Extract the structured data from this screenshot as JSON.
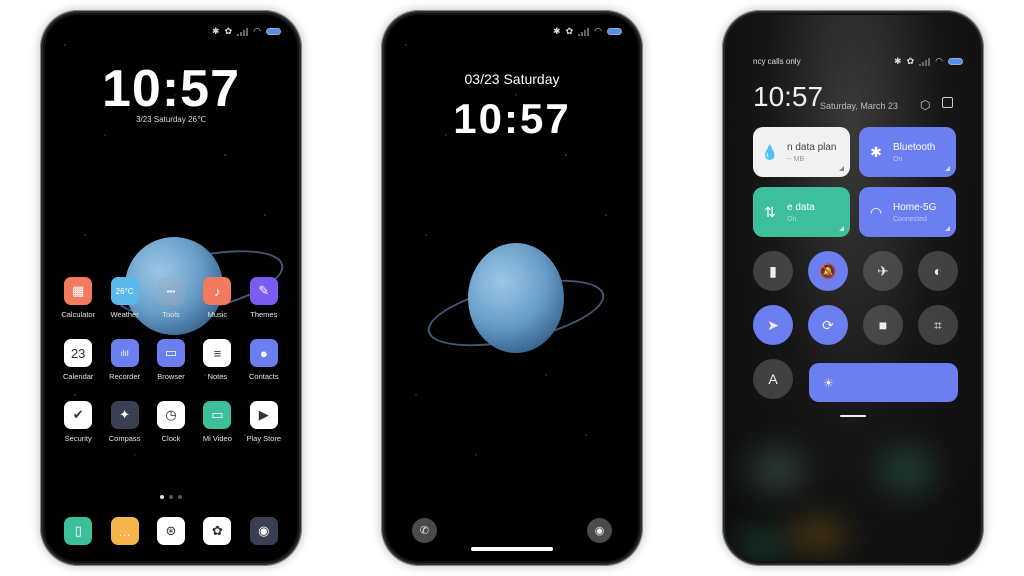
{
  "status_bar": {
    "icons": [
      "bluetooth-icon",
      "dnd-off-icon",
      "signal-icon",
      "wifi-icon",
      "battery-icon"
    ],
    "battery_color": "#4f8ef7"
  },
  "home": {
    "time": "10:57",
    "date_weather": "3/23  Saturday   26℃",
    "apps": [
      {
        "label": "Calculator",
        "icon": "calculator-icon",
        "color": "#f27a5e",
        "glyph": "▦"
      },
      {
        "label": "Weather",
        "icon": "weather-icon",
        "color": "#5ab8ea",
        "glyph": "26°C"
      },
      {
        "label": "Tools",
        "icon": "folder-icon",
        "color": "rgba(160,170,190,0.35)",
        "glyph": "▪▪▪"
      },
      {
        "label": "Music",
        "icon": "music-icon",
        "color": "#f27a5e",
        "glyph": "♪"
      },
      {
        "label": "Themes",
        "icon": "themes-icon",
        "color": "#7b5cf0",
        "glyph": "✎"
      },
      {
        "label": "Calendar",
        "icon": "calendar-icon",
        "color": "#ffffff",
        "glyph": "23"
      },
      {
        "label": "Recorder",
        "icon": "recorder-icon",
        "color": "#6b7ff0",
        "glyph": "ılıl"
      },
      {
        "label": "Browser",
        "icon": "browser-icon",
        "color": "#6b7ff0",
        "glyph": "▭"
      },
      {
        "label": "Notes",
        "icon": "notes-icon",
        "color": "#ffffff",
        "glyph": "≡"
      },
      {
        "label": "Contacts",
        "icon": "contacts-icon",
        "color": "#6b7ff0",
        "glyph": "●"
      },
      {
        "label": "Security",
        "icon": "security-icon",
        "color": "#ffffff",
        "glyph": "✔"
      },
      {
        "label": "Compass",
        "icon": "compass-icon",
        "color": "#3a3f52",
        "glyph": "✦"
      },
      {
        "label": "Clock",
        "icon": "clock-icon",
        "color": "#ffffff",
        "glyph": "◷"
      },
      {
        "label": "Mi Video",
        "icon": "video-icon",
        "color": "#3dbf9c",
        "glyph": "▭"
      },
      {
        "label": "Play Store",
        "icon": "play-store-icon",
        "color": "#ffffff",
        "glyph": "▶"
      }
    ],
    "page_dots": 3,
    "active_page": 0,
    "dock": [
      {
        "name": "phone-app",
        "icon": "phone-app-icon",
        "color": "#3dbf9c",
        "glyph": "▯"
      },
      {
        "name": "messages-app",
        "icon": "messages-icon",
        "color": "#f5b54a",
        "glyph": "…"
      },
      {
        "name": "steering-app",
        "icon": "steering-icon",
        "color": "#ffffff",
        "glyph": "⊛"
      },
      {
        "name": "gallery-app",
        "icon": "gallery-icon",
        "color": "#ffffff",
        "glyph": "✿"
      },
      {
        "name": "camera-app",
        "icon": "camera-icon",
        "color": "#3a3f52",
        "glyph": "◉"
      }
    ]
  },
  "lock": {
    "date": "03/23 Saturday",
    "time": "10:57",
    "phone_glyph": "✆",
    "camera_glyph": "◉"
  },
  "control_center": {
    "carrier": "ncy calls only",
    "time": "10:57",
    "date": "Saturday, March 23",
    "tiles": [
      {
        "name": "data-plan",
        "title": "n data plan",
        "sub": "-- MB",
        "glyph": "💧",
        "style": "white"
      },
      {
        "name": "bluetooth",
        "title": "Bluetooth",
        "sub": "On",
        "glyph": "✱",
        "style": "blue"
      },
      {
        "name": "mobile-data",
        "title": "e data",
        "sub": "On",
        "glyph": "⇅",
        "style": "green"
      },
      {
        "name": "wifi",
        "title": "Home-5G",
        "sub": "Connected",
        "glyph": "◠",
        "style": "blue"
      }
    ],
    "toggles": [
      {
        "name": "flashlight",
        "glyph": "▮",
        "on": false
      },
      {
        "name": "mute",
        "glyph": "🔕",
        "on": true
      },
      {
        "name": "airplane",
        "glyph": "✈",
        "on": false
      },
      {
        "name": "reading-mode",
        "glyph": "◐",
        "on": false
      },
      {
        "name": "location",
        "glyph": "➤",
        "on": true
      },
      {
        "name": "rotation-lock",
        "glyph": "⟳",
        "on": true
      },
      {
        "name": "screen-record",
        "glyph": "■",
        "on": false
      },
      {
        "name": "scanner",
        "glyph": "⌗",
        "on": false
      },
      {
        "name": "auto-brightness",
        "glyph": "A",
        "on": false
      }
    ],
    "brightness_glyph": "☀",
    "colors": {
      "accent": "#6b7ff0",
      "green": "#3dbf9c",
      "white_tile": "#f2f2f2"
    }
  }
}
